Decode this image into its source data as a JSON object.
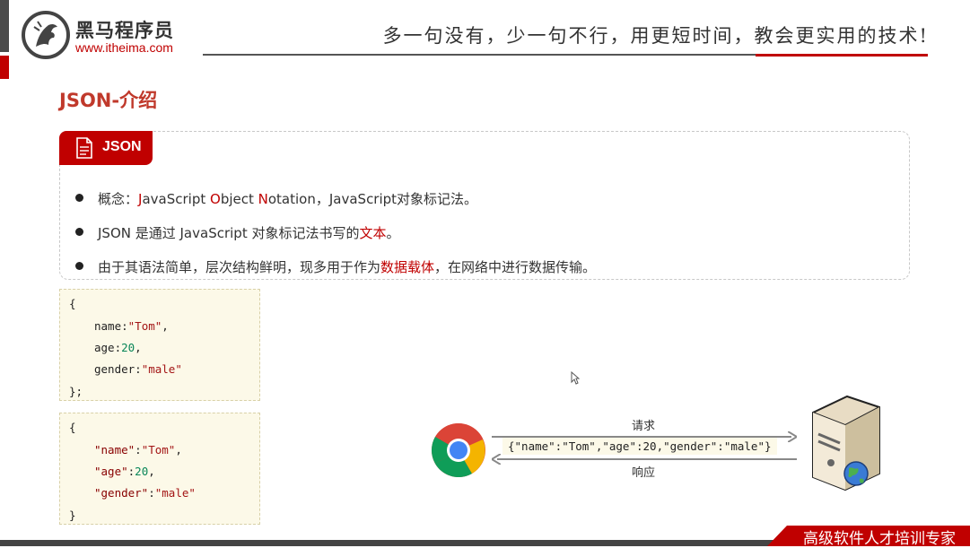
{
  "header": {
    "logo_cn": "黑马程序员",
    "logo_url": "www.itheima.com",
    "slogan": "多一句没有，少一句不行，用更短时间，教会更实用的技术!"
  },
  "page_title": "JSON-介绍",
  "definition": {
    "tab_label": "JSON",
    "bullet1": {
      "prefix": "概念：",
      "j": "J",
      "t1": "avaScript ",
      "o": "O",
      "t2": "bject ",
      "n": "N",
      "t3": "otation，JavaScript对象标记法。"
    },
    "bullet2": {
      "text": "JSON 是通过 JavaScript 对象标记法书写的",
      "highlight": "文本",
      "suffix": "。"
    },
    "bullet3": {
      "text": "由于其语法简单，层次结构鲜明，现多用于作为",
      "highlight": "数据载体",
      "suffix": "，在网络中进行数据传输。"
    }
  },
  "code_js": {
    "open": "{",
    "name_key": "name",
    "name_val": "\"Tom\"",
    "age_key": "age",
    "age_val": "20",
    "gender_key": "gender",
    "gender_val": "\"male\"",
    "close": "};"
  },
  "code_json": {
    "open": "{",
    "name_key": "\"name\"",
    "name_val": "\"Tom\"",
    "age_key": "\"age\"",
    "age_val": "20",
    "gender_key": "\"gender\"",
    "gender_val": "\"male\"",
    "close": "}"
  },
  "diagram": {
    "request_label": "请求",
    "response_label": "响应",
    "payload": "{\"name\":\"Tom\",\"age\":20,\"gender\":\"male\"}"
  },
  "footer": {
    "tag": "高级软件人才培训专家"
  },
  "colors": {
    "accent": "#c00000",
    "code_bg": "#fcf9e8"
  }
}
